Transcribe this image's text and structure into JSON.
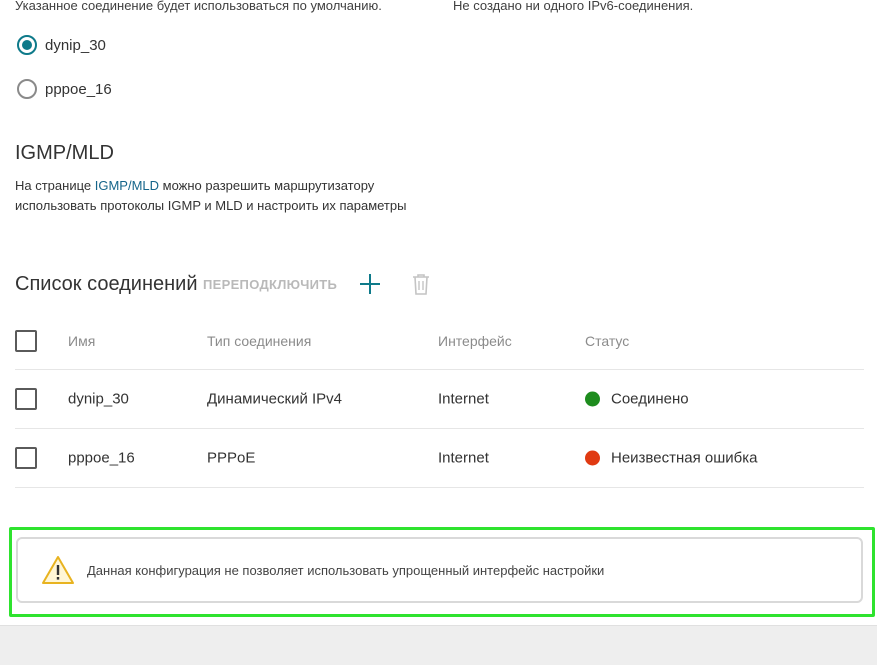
{
  "top_notes": {
    "left": "Указанное соединение будет использоваться по умолчанию.",
    "right": "Не создано ни одного IPv6-соединения."
  },
  "default_connection": {
    "options": [
      {
        "label": "dynip_30",
        "selected": true
      },
      {
        "label": "pppoe_16",
        "selected": false
      }
    ]
  },
  "igmp": {
    "title": "IGMP/MLD",
    "desc_prefix": "На странице ",
    "link": "IGMP/MLD",
    "desc_suffix": " можно разрешить маршрутизатору использовать протоколы IGMP и MLD и настроить их параметры"
  },
  "connections": {
    "title": "Список соединений",
    "reconnect_label": "ПЕРЕПОДКЛЮЧИТЬ",
    "add_icon": "plus-icon",
    "delete_icon": "trash-icon",
    "columns": [
      "Имя",
      "Тип соединения",
      "Интерфейс",
      "Статус"
    ],
    "rows": [
      {
        "name": "dynip_30",
        "type": "Динамический IPv4",
        "interface": "Internet",
        "status": "Соединено",
        "status_color": "#1e8c1e"
      },
      {
        "name": "pppoe_16",
        "type": "PPPoE",
        "interface": "Internet",
        "status": "Неизвестная ошибка",
        "status_color": "#e03a12"
      }
    ]
  },
  "warning": {
    "icon": "warning-triangle-icon",
    "text": "Данная конфигурация не позволяет использовать упрощенный интерфейс настройки",
    "highlight_color": "#2ee32e"
  },
  "colors": {
    "accent": "#0e7a8a",
    "link": "#15658a"
  }
}
